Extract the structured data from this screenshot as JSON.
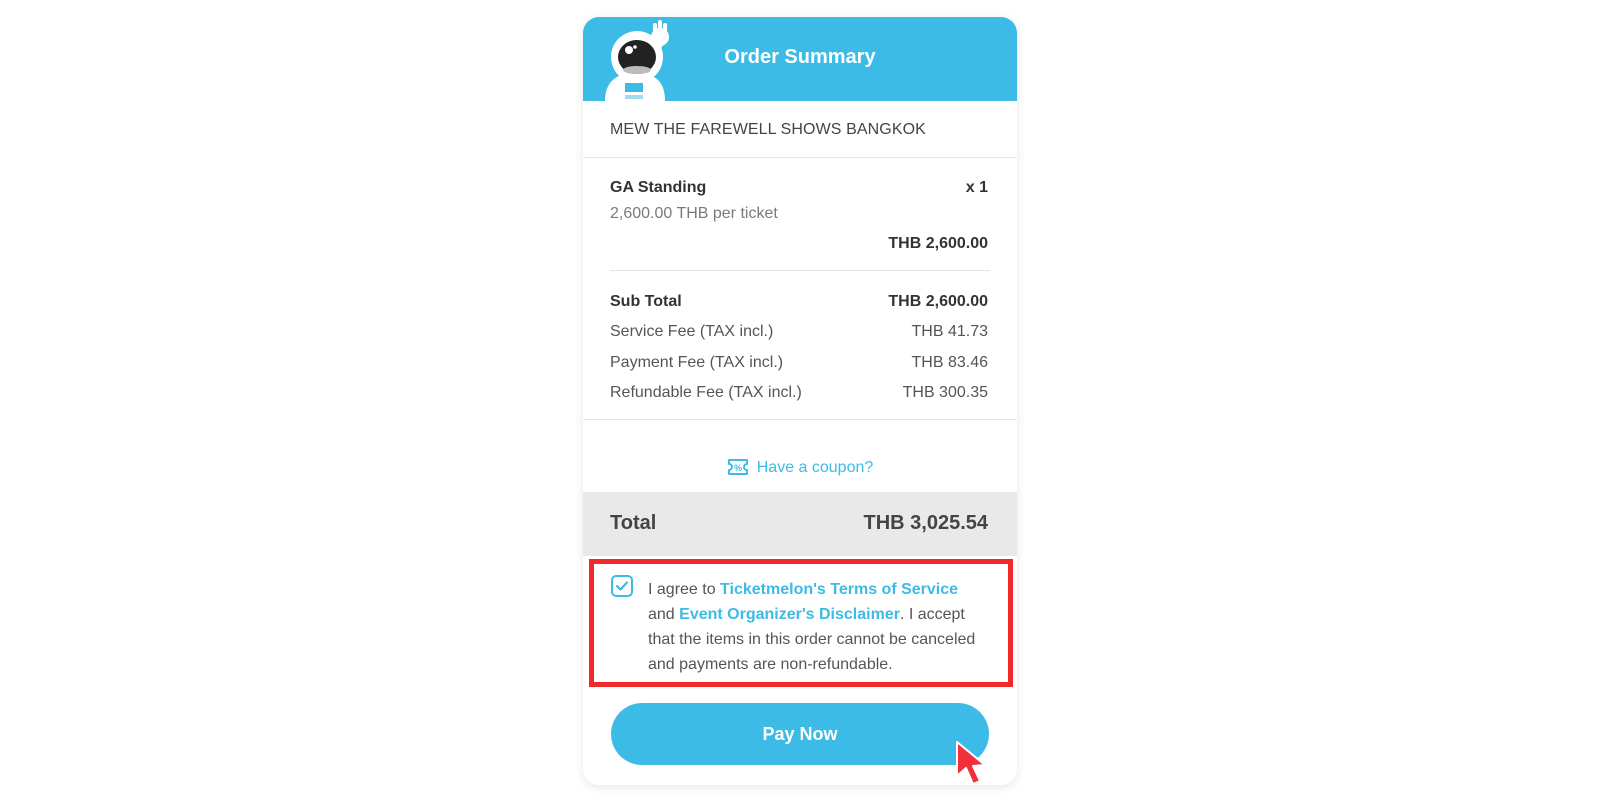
{
  "header": {
    "title": "Order Summary",
    "accent_color": "#3cbbe6"
  },
  "event": {
    "name": "MEW THE FAREWELL SHOWS BANGKOK"
  },
  "ticket": {
    "type": "GA Standing",
    "quantity": "x 1",
    "unit_price": "2,600.00 THB per ticket",
    "line_total": "THB 2,600.00"
  },
  "summary": {
    "subtotal_label": "Sub Total",
    "subtotal_value": "THB 2,600.00",
    "service_fee_label": "Service Fee (TAX incl.)",
    "service_fee_value": "THB 41.73",
    "payment_fee_label": "Payment Fee (TAX incl.)",
    "payment_fee_value": "THB 83.46",
    "refundable_fee_label": "Refundable Fee (TAX incl.)",
    "refundable_fee_value": "THB 300.35"
  },
  "coupon": {
    "label": "Have a coupon?",
    "icon": "coupon-icon"
  },
  "total": {
    "label": "Total",
    "value": "THB 3,025.54"
  },
  "agreement": {
    "checked": true,
    "text_1": "I agree to ",
    "terms_link": "Ticketmelon's Terms of Service",
    "text_2": " and ",
    "disclaimer_link": "Event Organizer's Disclaimer",
    "text_3": ". I accept that the items in this order cannot be canceled and payments are non-refundable.",
    "highlight_color": "#ee2a2a"
  },
  "actions": {
    "pay_label": "Pay Now"
  }
}
